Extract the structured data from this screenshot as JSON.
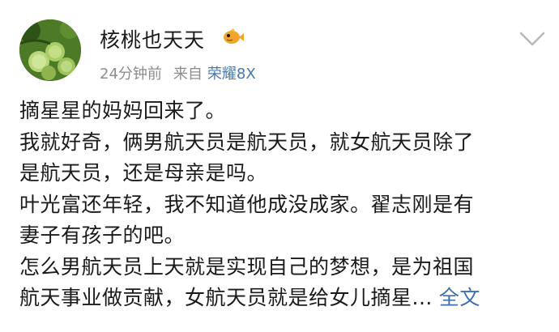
{
  "post": {
    "username": "核桃也天天",
    "time": "24分钟前",
    "source_prefix": "来自",
    "device": "荣耀8X",
    "lines": [
      "摘星星的妈妈回来了。",
      "我就好奇，俩男航天员是航天员，就女航天员除了",
      "是航天员，还是母亲是吗。",
      "叶光富还年轻，我不知道他成没成家。翟志刚是有",
      "妻子有孩子的吧。",
      "怎么男航天员上天就是实现自己的梦想，是为祖国"
    ],
    "last_line": "航天事业做贡献，女航天员就是给女儿摘星",
    "ellipsis": "...",
    "more_label": "全文"
  },
  "icons": {
    "avatar": "walnut-photo",
    "badge": "fish-emoji-icon",
    "chevron": "chevron-down-icon"
  }
}
